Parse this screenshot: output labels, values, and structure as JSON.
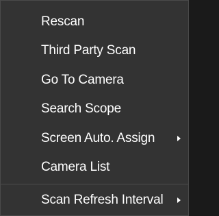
{
  "context_menu": {
    "items": [
      {
        "label": "Rescan",
        "has_submenu": false
      },
      {
        "label": "Third Party Scan",
        "has_submenu": false
      },
      {
        "label": "Go To Camera",
        "has_submenu": false
      },
      {
        "label": "Search Scope",
        "has_submenu": false
      },
      {
        "label": "Screen Auto. Assign",
        "has_submenu": true,
        "submenu_icon": "triangle-right-icon"
      },
      {
        "label": "Camera List",
        "has_submenu": false
      },
      {
        "label": "Scan Refresh Interval",
        "has_submenu": true,
        "submenu_icon": "triangle-right-icon"
      }
    ],
    "colors": {
      "background": "#333333",
      "text": "#ffffff",
      "border": "#4a4a4a"
    }
  }
}
